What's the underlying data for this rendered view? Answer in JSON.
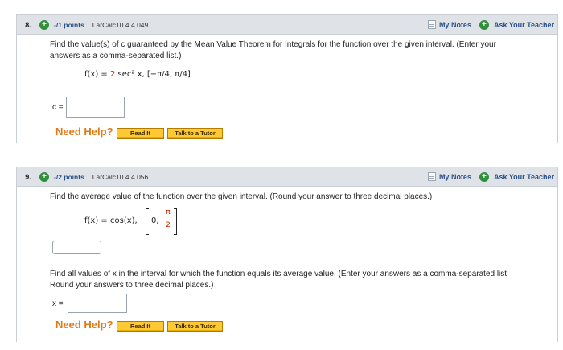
{
  "questions": [
    {
      "number": "8.",
      "points": "-/1 points",
      "source": "LarCalc10 4.4.049.",
      "my_notes": "My Notes",
      "ask": "Ask Your Teacher",
      "prompt_line1": "Find the value(s) of c guaranteed by the Mean Value Theorem for Integrals for the function over the given interval. (Enter your",
      "prompt_line2": "answers as a comma-separated list.)",
      "formula_lhs": "f(x) = ",
      "formula_coef": "2",
      "formula_rest": " sec² x,  [−π/4, π/4]",
      "answer_label": "c =",
      "answer_value": "",
      "need_help": "Need Help?",
      "read_it": "Read It",
      "talk_tutor": "Talk to a Tutor"
    },
    {
      "number": "9.",
      "points": "-/2 points",
      "source": "LarCalc10 4.4.056.",
      "my_notes": "My Notes",
      "ask": "Ask Your Teacher",
      "prompt": "Find the average value of the function over the given interval. (Round your answer to three decimal places.)",
      "formula_lhs": "f(x) = cos(x),",
      "interval_start": "0,",
      "interval_num": "π",
      "interval_den": "2",
      "answer1_value": "",
      "prompt2_line1": "Find all values of x in the interval for which the function equals its average value. (Enter your answers as a comma-separated list.",
      "prompt2_line2": "Round your answers to three decimal places.)",
      "answer2_label": "x =",
      "answer2_value": "",
      "need_help": "Need Help?",
      "read_it": "Read It",
      "talk_tutor": "Talk to a Tutor"
    }
  ],
  "colors": {
    "header_bg": "#dfe3e8",
    "link_blue": "#2a4f86",
    "help_orange": "#e07a16",
    "button_yellow": "#ffc933",
    "plus_green": "#2f8f3a",
    "coef_red": "#cc2200"
  },
  "icons": [
    "plus-circle-icon",
    "notes-icon"
  ]
}
